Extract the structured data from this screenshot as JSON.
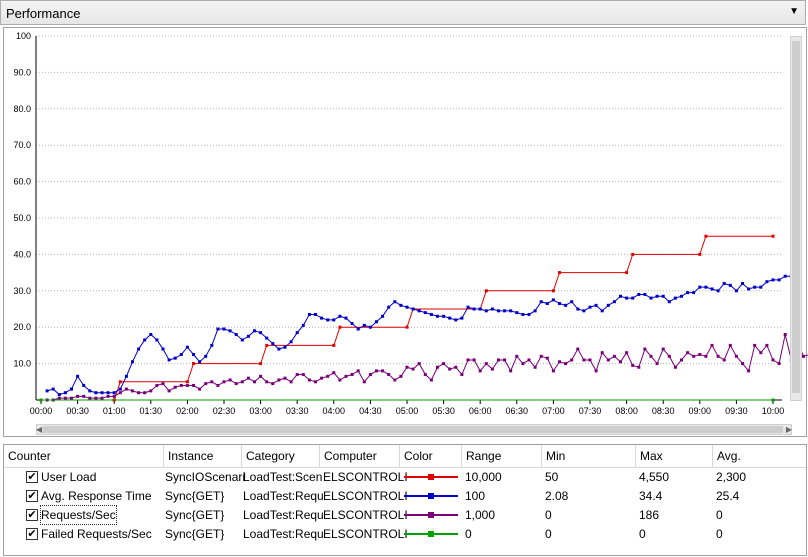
{
  "panel": {
    "title": "Performance"
  },
  "chart_data": {
    "type": "line",
    "ylim": [
      0,
      100
    ],
    "yticks": [
      "100",
      "90.0",
      "80.0",
      "70.0",
      "60.0",
      "50.0",
      "40.0",
      "30.0",
      "20.0",
      "10.0"
    ],
    "xlabels": [
      "00:00",
      "00:30",
      "01:00",
      "01:30",
      "02:00",
      "02:30",
      "03:00",
      "03:30",
      "04:00",
      "04:30",
      "05:00",
      "05:30",
      "06:00",
      "06:30",
      "07:00",
      "07:30",
      "08:00",
      "08:30",
      "09:00",
      "09:30",
      "10:00"
    ],
    "xlim": [
      0,
      600
    ],
    "series": [
      {
        "name": "User Load",
        "color": "#e00000",
        "points": [
          [
            0,
            0
          ],
          [
            60,
            0
          ],
          [
            60,
            0
          ],
          [
            65,
            5
          ],
          [
            120,
            5
          ],
          [
            125,
            10
          ],
          [
            180,
            10
          ],
          [
            185,
            15
          ],
          [
            240,
            15
          ],
          [
            245,
            20
          ],
          [
            300,
            20
          ],
          [
            305,
            25
          ],
          [
            360,
            25
          ],
          [
            365,
            30
          ],
          [
            420,
            30
          ],
          [
            425,
            35
          ],
          [
            480,
            35
          ],
          [
            485,
            40
          ],
          [
            540,
            40
          ],
          [
            545,
            45
          ],
          [
            600,
            45
          ]
        ]
      },
      {
        "name": "Avg. Response Time",
        "color": "#0000c8",
        "points": [
          [
            5,
            2.5
          ],
          [
            10,
            3
          ],
          [
            15,
            1.5
          ],
          [
            20,
            2
          ],
          [
            25,
            3
          ],
          [
            30,
            6.5
          ],
          [
            35,
            4
          ],
          [
            40,
            2.5
          ],
          [
            45,
            2
          ],
          [
            50,
            2
          ],
          [
            55,
            2
          ],
          [
            60,
            2
          ],
          [
            65,
            3
          ],
          [
            70,
            6.5
          ],
          [
            75,
            10.5
          ],
          [
            80,
            14
          ],
          [
            85,
            16.5
          ],
          [
            90,
            18
          ],
          [
            95,
            16.5
          ],
          [
            100,
            14
          ],
          [
            105,
            11
          ],
          [
            110,
            11.5
          ],
          [
            115,
            12.5
          ],
          [
            120,
            14.5
          ],
          [
            125,
            12.5
          ],
          [
            130,
            10.5
          ],
          [
            135,
            12
          ],
          [
            140,
            15
          ],
          [
            145,
            19.5
          ],
          [
            150,
            19.5
          ],
          [
            155,
            19
          ],
          [
            160,
            18
          ],
          [
            165,
            16.5
          ],
          [
            170,
            17.5
          ],
          [
            175,
            19
          ],
          [
            180,
            18.5
          ],
          [
            185,
            17
          ],
          [
            190,
            15.5
          ],
          [
            195,
            14
          ],
          [
            200,
            14.5
          ],
          [
            205,
            16
          ],
          [
            210,
            18.5
          ],
          [
            215,
            20.5
          ],
          [
            220,
            23.5
          ],
          [
            225,
            23.5
          ],
          [
            230,
            22.5
          ],
          [
            235,
            22
          ],
          [
            240,
            22
          ],
          [
            245,
            23
          ],
          [
            250,
            22.5
          ],
          [
            255,
            21
          ],
          [
            260,
            19.5
          ],
          [
            265,
            20.5
          ],
          [
            270,
            20
          ],
          [
            275,
            21.5
          ],
          [
            280,
            23
          ],
          [
            285,
            25.5
          ],
          [
            290,
            27
          ],
          [
            295,
            26
          ],
          [
            300,
            25.5
          ],
          [
            305,
            25
          ],
          [
            310,
            24.5
          ],
          [
            315,
            24
          ],
          [
            320,
            23.5
          ],
          [
            325,
            23
          ],
          [
            330,
            23
          ],
          [
            335,
            22.5
          ],
          [
            340,
            22
          ],
          [
            345,
            22.5
          ],
          [
            350,
            25.5
          ],
          [
            355,
            25
          ],
          [
            360,
            25
          ],
          [
            365,
            24.5
          ],
          [
            370,
            25
          ],
          [
            375,
            24.5
          ],
          [
            380,
            24.5
          ],
          [
            385,
            24.5
          ],
          [
            390,
            24
          ],
          [
            395,
            23.5
          ],
          [
            400,
            23.5
          ],
          [
            405,
            24.5
          ],
          [
            410,
            27
          ],
          [
            415,
            26.5
          ],
          [
            420,
            27.5
          ],
          [
            425,
            26.5
          ],
          [
            430,
            26
          ],
          [
            435,
            27
          ],
          [
            440,
            25
          ],
          [
            445,
            24.5
          ],
          [
            450,
            25.5
          ],
          [
            455,
            26
          ],
          [
            460,
            24.5
          ],
          [
            465,
            26
          ],
          [
            470,
            27
          ],
          [
            475,
            28.5
          ],
          [
            480,
            28
          ],
          [
            485,
            28
          ],
          [
            490,
            29
          ],
          [
            495,
            29
          ],
          [
            500,
            28
          ],
          [
            505,
            28.5
          ],
          [
            510,
            28.5
          ],
          [
            515,
            27
          ],
          [
            520,
            28
          ],
          [
            525,
            28.5
          ],
          [
            530,
            29.5
          ],
          [
            535,
            29.5
          ],
          [
            540,
            31
          ],
          [
            545,
            31
          ],
          [
            550,
            30.5
          ],
          [
            555,
            30
          ],
          [
            560,
            32
          ],
          [
            565,
            31.5
          ],
          [
            570,
            30
          ],
          [
            575,
            32
          ],
          [
            580,
            30.5
          ],
          [
            585,
            31
          ],
          [
            590,
            31
          ],
          [
            595,
            32.5
          ],
          [
            600,
            33
          ],
          [
            605,
            33
          ],
          [
            610,
            34
          ],
          [
            615,
            34
          ]
        ]
      },
      {
        "name": "Requests/Sec",
        "color": "#7a007a",
        "points": [
          [
            5,
            0
          ],
          [
            10,
            0
          ],
          [
            15,
            0.5
          ],
          [
            20,
            0.5
          ],
          [
            25,
            0.5
          ],
          [
            30,
            1
          ],
          [
            35,
            1
          ],
          [
            40,
            0.5
          ],
          [
            45,
            0.5
          ],
          [
            50,
            0.5
          ],
          [
            55,
            1
          ],
          [
            60,
            1
          ],
          [
            65,
            2
          ],
          [
            70,
            3
          ],
          [
            75,
            2.5
          ],
          [
            80,
            2
          ],
          [
            85,
            2
          ],
          [
            90,
            2.5
          ],
          [
            95,
            4
          ],
          [
            100,
            4.5
          ],
          [
            105,
            2.5
          ],
          [
            110,
            3.5
          ],
          [
            115,
            4
          ],
          [
            120,
            4
          ],
          [
            125,
            4
          ],
          [
            130,
            3
          ],
          [
            135,
            4.5
          ],
          [
            140,
            5
          ],
          [
            145,
            4
          ],
          [
            150,
            5
          ],
          [
            155,
            5.5
          ],
          [
            160,
            4.5
          ],
          [
            165,
            5
          ],
          [
            170,
            6
          ],
          [
            175,
            5
          ],
          [
            180,
            6.5
          ],
          [
            185,
            5
          ],
          [
            190,
            4.5
          ],
          [
            195,
            5.5
          ],
          [
            200,
            6
          ],
          [
            205,
            5
          ],
          [
            210,
            7
          ],
          [
            215,
            7
          ],
          [
            220,
            5.5
          ],
          [
            225,
            5
          ],
          [
            230,
            6
          ],
          [
            235,
            6.5
          ],
          [
            240,
            7.5
          ],
          [
            245,
            5.5
          ],
          [
            250,
            6.5
          ],
          [
            255,
            7
          ],
          [
            260,
            8
          ],
          [
            265,
            5
          ],
          [
            270,
            7
          ],
          [
            275,
            8
          ],
          [
            280,
            8
          ],
          [
            285,
            7
          ],
          [
            290,
            5.5
          ],
          [
            295,
            6.5
          ],
          [
            300,
            9
          ],
          [
            305,
            8.5
          ],
          [
            310,
            10
          ],
          [
            315,
            7
          ],
          [
            320,
            5.5
          ],
          [
            325,
            9
          ],
          [
            330,
            10
          ],
          [
            335,
            8.5
          ],
          [
            340,
            9
          ],
          [
            345,
            7
          ],
          [
            350,
            11
          ],
          [
            355,
            11
          ],
          [
            360,
            8
          ],
          [
            365,
            10
          ],
          [
            370,
            8.5
          ],
          [
            375,
            11
          ],
          [
            380,
            11
          ],
          [
            385,
            8
          ],
          [
            390,
            12
          ],
          [
            395,
            10
          ],
          [
            400,
            11
          ],
          [
            405,
            9
          ],
          [
            410,
            12
          ],
          [
            415,
            11.5
          ],
          [
            420,
            8
          ],
          [
            425,
            10.5
          ],
          [
            430,
            10
          ],
          [
            435,
            11
          ],
          [
            440,
            14
          ],
          [
            445,
            11
          ],
          [
            450,
            11
          ],
          [
            455,
            8
          ],
          [
            460,
            13
          ],
          [
            465,
            11
          ],
          [
            470,
            12
          ],
          [
            475,
            10.5
          ],
          [
            480,
            13
          ],
          [
            485,
            9.5
          ],
          [
            490,
            9
          ],
          [
            495,
            14
          ],
          [
            500,
            12
          ],
          [
            505,
            10
          ],
          [
            510,
            14
          ],
          [
            515,
            12
          ],
          [
            520,
            9
          ],
          [
            525,
            11
          ],
          [
            530,
            13
          ],
          [
            535,
            12
          ],
          [
            540,
            12.5
          ],
          [
            545,
            12
          ],
          [
            550,
            15
          ],
          [
            555,
            12
          ],
          [
            560,
            11
          ],
          [
            565,
            15
          ],
          [
            570,
            12
          ],
          [
            575,
            10
          ],
          [
            580,
            8
          ],
          [
            585,
            15
          ],
          [
            590,
            13
          ],
          [
            595,
            15
          ],
          [
            600,
            11
          ],
          [
            605,
            10
          ],
          [
            610,
            18
          ],
          [
            615,
            11
          ],
          [
            620,
            16
          ],
          [
            625,
            12
          ],
          [
            630,
            12.5
          ]
        ]
      },
      {
        "name": "Failed Requests/Sec",
        "color": "#00a000",
        "points": [
          [
            0,
            0
          ],
          [
            600,
            0
          ]
        ]
      }
    ]
  },
  "table": {
    "headers": [
      "Counter",
      "Instance",
      "Category",
      "Computer",
      "Color",
      "Range",
      "Min",
      "Max",
      "Avg."
    ],
    "rows": [
      {
        "counter": "User Load",
        "instance": "SyncIOScenari",
        "category": "LoadTest:Scen",
        "computer": "ELSCONTROLI",
        "color": "#e00000",
        "range": "10,000",
        "min": "50",
        "max": "4,550",
        "avg": "2,300",
        "checked": "✔"
      },
      {
        "counter": "Avg. Response Time",
        "instance": "Sync{GET}",
        "category": "LoadTest:Requ",
        "computer": "ELSCONTROLI",
        "color": "#0000c8",
        "range": "100",
        "min": "2.08",
        "max": "34.4",
        "avg": "25.4",
        "checked": "✔"
      },
      {
        "counter": "Requests/Sec",
        "instance": "Sync{GET}",
        "category": "LoadTest:Requ",
        "computer": "ELSCONTROLI",
        "color": "#7a007a",
        "range": "1,000",
        "min": "0",
        "max": "186",
        "avg": "0",
        "checked": "✔"
      },
      {
        "counter": "Failed Requests/Sec",
        "instance": "Sync{GET}",
        "category": "LoadTest:Requ",
        "computer": "ELSCONTROLI",
        "color": "#00a000",
        "range": "0",
        "min": "0",
        "max": "0",
        "avg": "0",
        "checked": "✔"
      }
    ]
  }
}
